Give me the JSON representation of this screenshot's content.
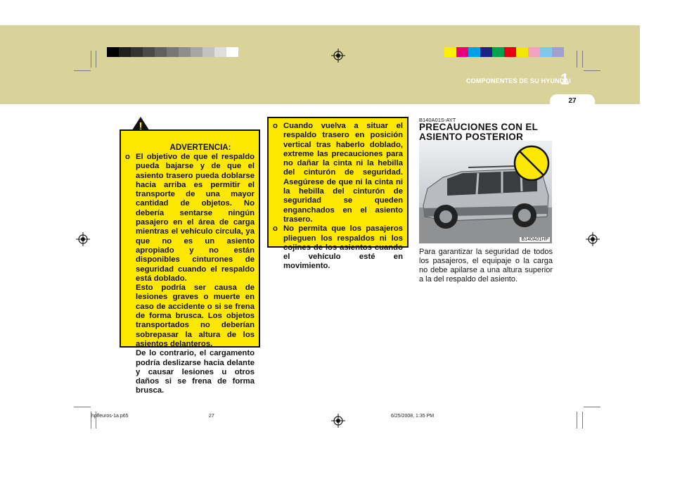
{
  "header": {
    "chapter_title": "COMPONENTES DE SU HYUNDAI",
    "chapter_number": "1",
    "page_number": "27",
    "gray_swatches": [
      "#000000",
      "#1e1e1e",
      "#333333",
      "#4a4a4a",
      "#606060",
      "#777777",
      "#8e8e8e",
      "#a6a6a6",
      "#c2c2c2",
      "#dedede",
      "#ffffff"
    ],
    "color_swatches": [
      "#ffee00",
      "#e6007e",
      "#00a0e9",
      "#1d2088",
      "#00a34d",
      "#e60012",
      "#f5e60a",
      "#f4a0c0",
      "#7fc7ee",
      "#a0a0d0"
    ]
  },
  "warning": {
    "icon": "warning-triangle-icon",
    "symbol": "!",
    "title": "ADVERTENCIA:",
    "bullet": "o",
    "text": "El objetivo de que el respaldo pueda bajarse y de que el asiento trasero pueda doblarse hacia arriba es permitir el transporte de una mayor cantidad de objetos. No debería sentarse ningún pasajero en el área de carga mientras el vehículo circula, ya que no es un asiento apropiado y no están disponibles cinturones de seguridad cuando el respaldo está doblado.",
    "text2": "Esto podría ser causa de lesiones graves o muerte en caso de accidente o si se frena de forma brusca. Los objetos transportados no deberían sobrepasar la altura de los asientos delanteros.",
    "text3": "De lo contrario, el cargamento podría deslizarse hacia delante y causar lesiones u otros daños si se frena de forma brusca."
  },
  "caution": {
    "items": [
      {
        "bullet": "o",
        "text": "Cuando vuelva a situar el respaldo trasero en posición vertical tras haberlo doblado, extreme las precauciones para no dañar la cinta ni la hebilla del cinturón de seguridad. Asegúrese de que ni la cinta ni la hebilla del cinturón de seguridad se queden enganchados en el asiento trasero."
      },
      {
        "bullet": "o",
        "text": "No permita que los pasajeros plieguen los respaldos ni los cojines de los asientos cuando el vehículo esté en movimiento."
      }
    ]
  },
  "section": {
    "code": "B140A01S-AYT",
    "heading": "PRECAUCIONES CON EL ASIENTO POSTERIOR",
    "figure_code": "B140A01HP",
    "prohibited_icon": "no-symbol-icon",
    "body": "Para garantizar la seguridad de todos los pasajeros, el equipaje o la carga no debe apilarse a una altura superior a la del respaldo del asiento."
  },
  "footer": {
    "file": "hpfleuros-1a.p65",
    "page": "27",
    "datetime": "6/25/2008, 1:35 PM"
  }
}
